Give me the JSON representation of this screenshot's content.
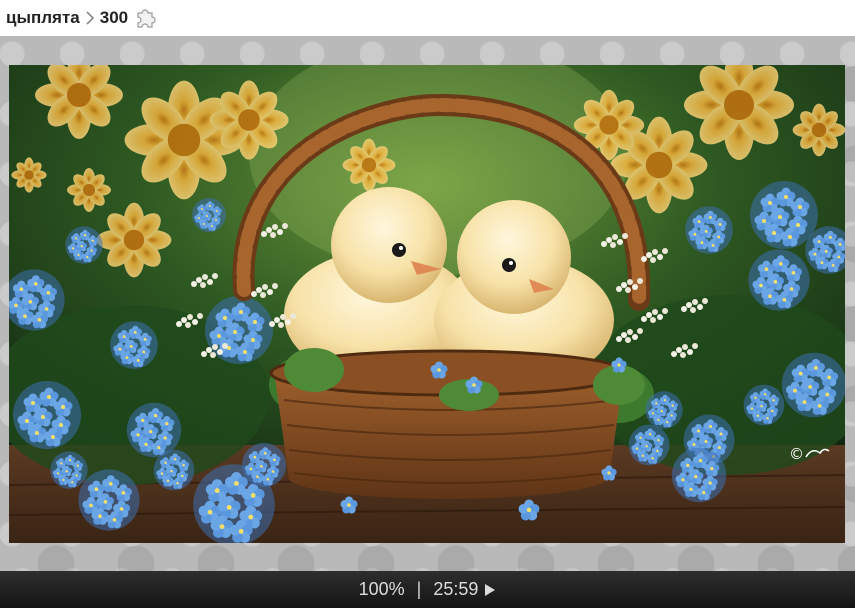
{
  "header": {
    "category": "цыплята",
    "piece_count": "300",
    "piece_icon": "puzzle-piece-icon"
  },
  "puzzle": {
    "watermark": "©"
  },
  "status": {
    "progress_text": "100%",
    "separator": "|",
    "timer": "25:59",
    "play_icon": "play-icon"
  },
  "colors": {
    "board": "#b9b9b9",
    "statusbar": "#1e1e1e",
    "status_text": "#dcdcdc"
  }
}
